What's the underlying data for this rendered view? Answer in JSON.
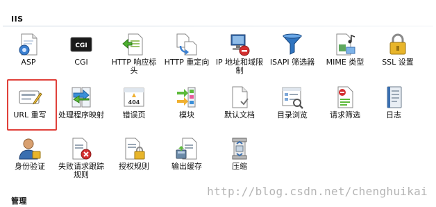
{
  "sections": {
    "iis": "IIS",
    "manage": "管理"
  },
  "items": {
    "asp": "ASP",
    "cgi": "CGI",
    "cgi_icon_text": "CGI",
    "http_response_headers": "HTTP 响应标头",
    "http_redirect": "HTTP 重定向",
    "ip_restrictions": "IP 地址和域限制",
    "isapi_filters": "ISAPI 筛选器",
    "mime_types": "MIME 类型",
    "ssl_settings": "SSL 设置",
    "url_rewrite": "URL 重写",
    "handler_mappings": "处理程序映射",
    "error_pages": "错误页",
    "error_pages_icon_text": "404",
    "modules": "模块",
    "default_document": "默认文档",
    "directory_browsing": "目录浏览",
    "request_filtering": "请求筛选",
    "logging": "日志",
    "authentication": "身份验证",
    "failed_request_tracing": "失败请求跟踪规则",
    "authorization_rules": "授权规则",
    "output_caching": "输出缓存",
    "compression": "压缩"
  },
  "watermark": "http://blog.csdn.net/chenghuikai",
  "colors": {
    "selection_border": "#e0403a",
    "section_rule": "#c9d4df"
  }
}
